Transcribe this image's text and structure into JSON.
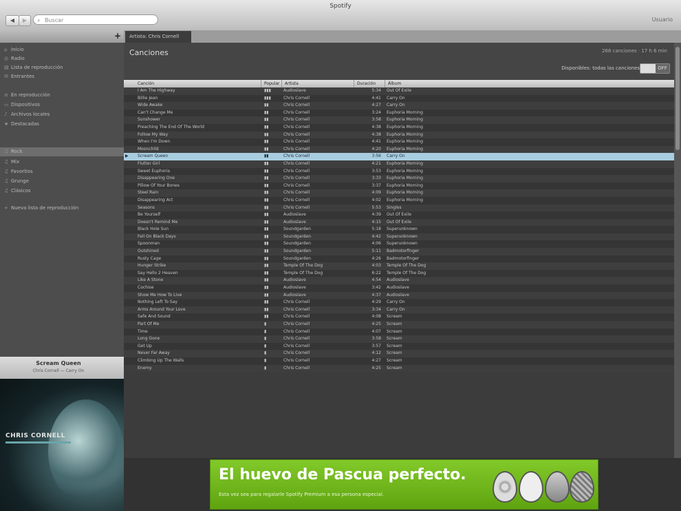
{
  "window": {
    "title": "Spotify"
  },
  "toolbar": {
    "back_label": "◀",
    "forward_label": "▶",
    "search_placeholder": "Buscar",
    "user_label": "Usuario"
  },
  "tab": {
    "label": "Artista: Chris Cornell"
  },
  "sidebar": {
    "items": [
      {
        "icon": "home-icon",
        "glyph": "⌂",
        "label": "Inicio"
      },
      {
        "icon": "radio-icon",
        "glyph": "◎",
        "label": "Radio"
      },
      {
        "icon": "app-icon",
        "glyph": "▤",
        "label": "Lista de reproducción"
      },
      {
        "icon": "inbox-icon",
        "glyph": "✉",
        "label": "Entrantes"
      },
      {
        "icon": "queue-icon",
        "glyph": "≡",
        "label": "En reproducción"
      },
      {
        "icon": "devices-icon",
        "glyph": "▭",
        "label": "Dispositivos"
      },
      {
        "icon": "local-files-icon",
        "glyph": "♪",
        "label": "Archivos locales"
      },
      {
        "icon": "starred-icon",
        "glyph": "★",
        "label": "Destacadas"
      },
      {
        "icon": "playlist-icon",
        "glyph": "♫",
        "label": "Rock"
      },
      {
        "icon": "playlist-icon",
        "glyph": "♫",
        "label": "Mix"
      },
      {
        "icon": "playlist-icon",
        "glyph": "♫",
        "label": "Favoritos"
      },
      {
        "icon": "playlist-icon",
        "glyph": "♫",
        "label": "Grunge"
      },
      {
        "icon": "playlist-icon",
        "glyph": "♫",
        "label": "Clásicos"
      },
      {
        "icon": "add-icon",
        "glyph": "+",
        "label": "Nueva lista de reproducción"
      }
    ]
  },
  "now_playing": {
    "title": "Scream Queen",
    "artist": "Chris Cornell — Carry On"
  },
  "cover": {
    "artist_text": "CHRIS CORNELL"
  },
  "main": {
    "heading": "Canciones",
    "stats": "268 canciones · 17 h 6 min",
    "available_label": "Disponibles: todas las canciones",
    "toggle_label": "OFF"
  },
  "table": {
    "columns": [
      "Canción",
      "Popular",
      "Artista",
      "Duración",
      "Álbum"
    ],
    "rows": [
      [
        "I Am The Highway",
        "▮▮▮",
        "Audioslave",
        "5:34",
        "Out Of Exile"
      ],
      [
        "Billie Jean",
        "▮▮▮",
        "Chris Cornell",
        "4:41",
        "Carry On"
      ],
      [
        "Wide Awake",
        "▮▮",
        "Chris Cornell",
        "4:27",
        "Carry On"
      ],
      [
        "Can't Change Me",
        "▮▮",
        "Chris Cornell",
        "3:24",
        "Euphoria Morning"
      ],
      [
        "Sunshower",
        "▮▮",
        "Chris Cornell",
        "3:58",
        "Euphoria Morning"
      ],
      [
        "Preaching The End Of The World",
        "▮▮",
        "Chris Cornell",
        "4:38",
        "Euphoria Morning"
      ],
      [
        "Follow My Way",
        "▮▮",
        "Chris Cornell",
        "4:38",
        "Euphoria Morning"
      ],
      [
        "When I'm Down",
        "▮▮",
        "Chris Cornell",
        "4:41",
        "Euphoria Morning"
      ],
      [
        "Moonchild",
        "▮▮",
        "Chris Cornell",
        "4:20",
        "Euphoria Morning"
      ],
      [
        "Scream Queen",
        "▮▮",
        "Chris Cornell",
        "3:56",
        "Carry On"
      ],
      [
        "Flutter Girl",
        "▮▮",
        "Chris Cornell",
        "4:21",
        "Euphoria Morning"
      ],
      [
        "Sweet Euphoria",
        "▮▮",
        "Chris Cornell",
        "3:53",
        "Euphoria Morning"
      ],
      [
        "Disappearing One",
        "▮▮",
        "Chris Cornell",
        "3:33",
        "Euphoria Morning"
      ],
      [
        "Pillow Of Your Bones",
        "▮▮",
        "Chris Cornell",
        "3:37",
        "Euphoria Morning"
      ],
      [
        "Steel Rain",
        "▮▮",
        "Chris Cornell",
        "4:09",
        "Euphoria Morning"
      ],
      [
        "Disappearing Act",
        "▮▮",
        "Chris Cornell",
        "4:02",
        "Euphoria Morning"
      ],
      [
        "Seasons",
        "▮▮",
        "Chris Cornell",
        "5:53",
        "Singles"
      ],
      [
        "Be Yourself",
        "▮▮",
        "Audioslave",
        "4:39",
        "Out Of Exile"
      ],
      [
        "Doesn't Remind Me",
        "▮▮",
        "Audioslave",
        "4:15",
        "Out Of Exile"
      ],
      [
        "Black Hole Sun",
        "▮▮",
        "Soundgarden",
        "5:18",
        "Superunknown"
      ],
      [
        "Fell On Black Days",
        "▮▮",
        "Soundgarden",
        "4:42",
        "Superunknown"
      ],
      [
        "Spoonman",
        "▮▮",
        "Soundgarden",
        "4:06",
        "Superunknown"
      ],
      [
        "Outshined",
        "▮▮",
        "Soundgarden",
        "5:11",
        "Badmotorfinger"
      ],
      [
        "Rusty Cage",
        "▮▮",
        "Soundgarden",
        "4:26",
        "Badmotorfinger"
      ],
      [
        "Hunger Strike",
        "▮▮",
        "Temple Of The Dog",
        "4:03",
        "Temple Of The Dog"
      ],
      [
        "Say Hello 2 Heaven",
        "▮▮",
        "Temple Of The Dog",
        "6:22",
        "Temple Of The Dog"
      ],
      [
        "Like A Stone",
        "▮▮",
        "Audioslave",
        "4:54",
        "Audioslave"
      ],
      [
        "Cochise",
        "▮▮",
        "Audioslave",
        "3:42",
        "Audioslave"
      ],
      [
        "Show Me How To Live",
        "▮▮",
        "Audioslave",
        "4:37",
        "Audioslave"
      ],
      [
        "Nothing Left To Say",
        "▮▮",
        "Chris Cornell",
        "4:29",
        "Carry On"
      ],
      [
        "Arms Around Your Love",
        "▮▮",
        "Chris Cornell",
        "3:34",
        "Carry On"
      ],
      [
        "Safe And Sound",
        "▮▮",
        "Chris Cornell",
        "4:08",
        "Scream"
      ],
      [
        "Part Of Me",
        "▮",
        "Chris Cornell",
        "4:25",
        "Scream"
      ],
      [
        "Time",
        "▮",
        "Chris Cornell",
        "4:07",
        "Scream"
      ],
      [
        "Long Gone",
        "▮",
        "Chris Cornell",
        "3:58",
        "Scream"
      ],
      [
        "Get Up",
        "▮",
        "Chris Cornell",
        "3:57",
        "Scream"
      ],
      [
        "Never Far Away",
        "▮",
        "Chris Cornell",
        "4:12",
        "Scream"
      ],
      [
        "Climbing Up The Walls",
        "▮",
        "Chris Cornell",
        "4:27",
        "Scream"
      ],
      [
        "Enemy",
        "▮",
        "Chris Cornell",
        "4:25",
        "Scream"
      ]
    ],
    "selected_row": 9
  },
  "ad": {
    "headline": "El huevo de Pascua perfecto.",
    "subline": "Esta vez sea para regalarle Spotify Premium a esa persona especial."
  }
}
